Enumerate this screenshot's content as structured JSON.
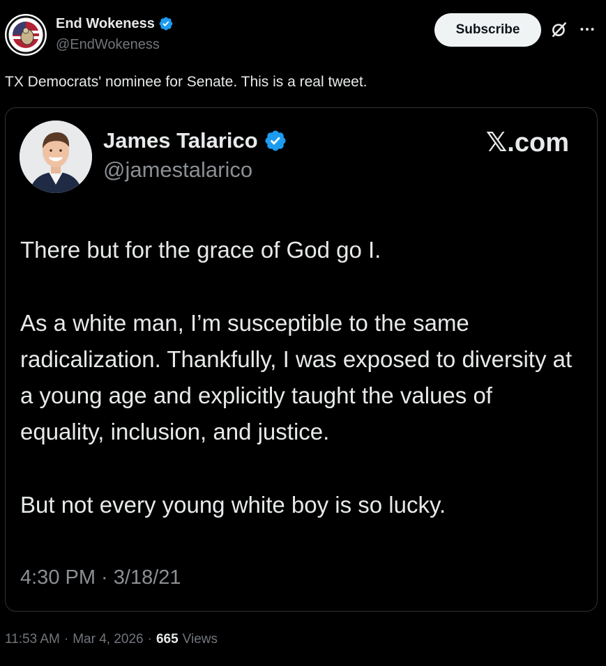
{
  "post": {
    "author_name": "End Wokeness",
    "author_handle": "@EndWokeness",
    "subscribe_label": "Subscribe",
    "text": "TX Democrats' nominee for Senate. This is a real tweet.",
    "timestamp": "11:53 AM",
    "separator": "·",
    "date": "Mar 4, 2026",
    "views_count": "665",
    "views_label": "Views",
    "icons": [
      "verified-badge-icon",
      "grok-icon",
      "more-icon"
    ]
  },
  "embedded": {
    "author_name": "James Talarico",
    "author_handle": "@jamestalarico",
    "brand": "𝕏.com",
    "paragraphs": [
      "There but for the grace of God go I.",
      "As a white man, I’m susceptible to the same radicalization. Thankfully, I was exposed to diversity at a young age and explicitly taught the values of equality, inclusion, and justice.",
      "But not every young white boy is so lucky."
    ],
    "timestamp": "4:30 PM · 3/18/21"
  },
  "colors": {
    "background": "#000000",
    "text_primary": "#e7e9ea",
    "text_secondary": "#71767b",
    "verified_blue": "#1d9bf0",
    "button_bg": "#eff3f4",
    "border": "#2f3336"
  }
}
